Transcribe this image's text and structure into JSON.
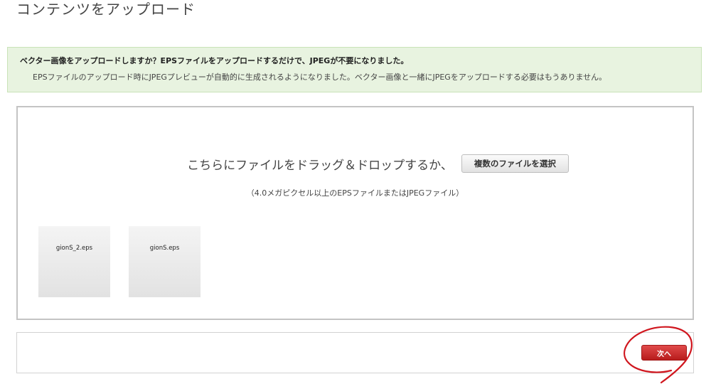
{
  "page": {
    "title": "コンテンツをアップロード"
  },
  "notice": {
    "headline": "ベクター画像をアップロードしますか？EPSファイルをアップロードするだけで、JPEGが不要になりました。",
    "body": "EPSファイルのアップロード時にJPEGプレビューが自動的に生成されるようになりました。ベクター画像と一緒にJPEGをアップロードする必要はもうありません。",
    "background_color": "#e8f3e0"
  },
  "dropzone": {
    "prompt": "こちらにファイルをドラッグ＆ドロップするか、",
    "select_button_label": "複数のファイルを選択",
    "hint": "（4.0メガピクセル以上のEPSファイルまたはJPEGファイル）",
    "files": [
      {
        "name": "gionS_2.eps"
      },
      {
        "name": "gionS.eps"
      }
    ]
  },
  "footer": {
    "next_button_label": "次へ",
    "next_button_color": "#c62828",
    "annotation_color": "#d0161e"
  }
}
